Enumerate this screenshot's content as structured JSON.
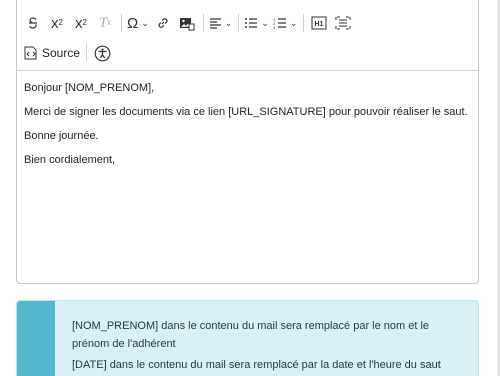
{
  "toolbar": {
    "row1": [
      "strikethrough-icon",
      "subscript-icon",
      "superscript-icon",
      "remove-format-icon",
      "special-chars-icon",
      "link-icon",
      "image-icon",
      "align-icon",
      "bulleted-list-icon",
      "numbered-list-icon",
      "heading-icon",
      "show-blocks-icon"
    ],
    "source_label": "Source"
  },
  "content": {
    "lines": [
      "Bonjour [NOM_PRENOM],",
      "Merci de signer les documents via ce lien [URL_SIGNATURE] pour pouvoir réaliser le saut.",
      "Bonne journée.",
      "Bien cordialement,"
    ]
  },
  "info": {
    "line1": "[NOM_PRENOM] dans le contenu du mail sera remplacé par le nom et le prénom de l'adhérent",
    "line2": "[DATE] dans le contenu du mail sera remplacé par la date et l'heure du saut"
  },
  "colors": {
    "accent": "#53b7cd",
    "info_bg": "#d9f1f5"
  }
}
